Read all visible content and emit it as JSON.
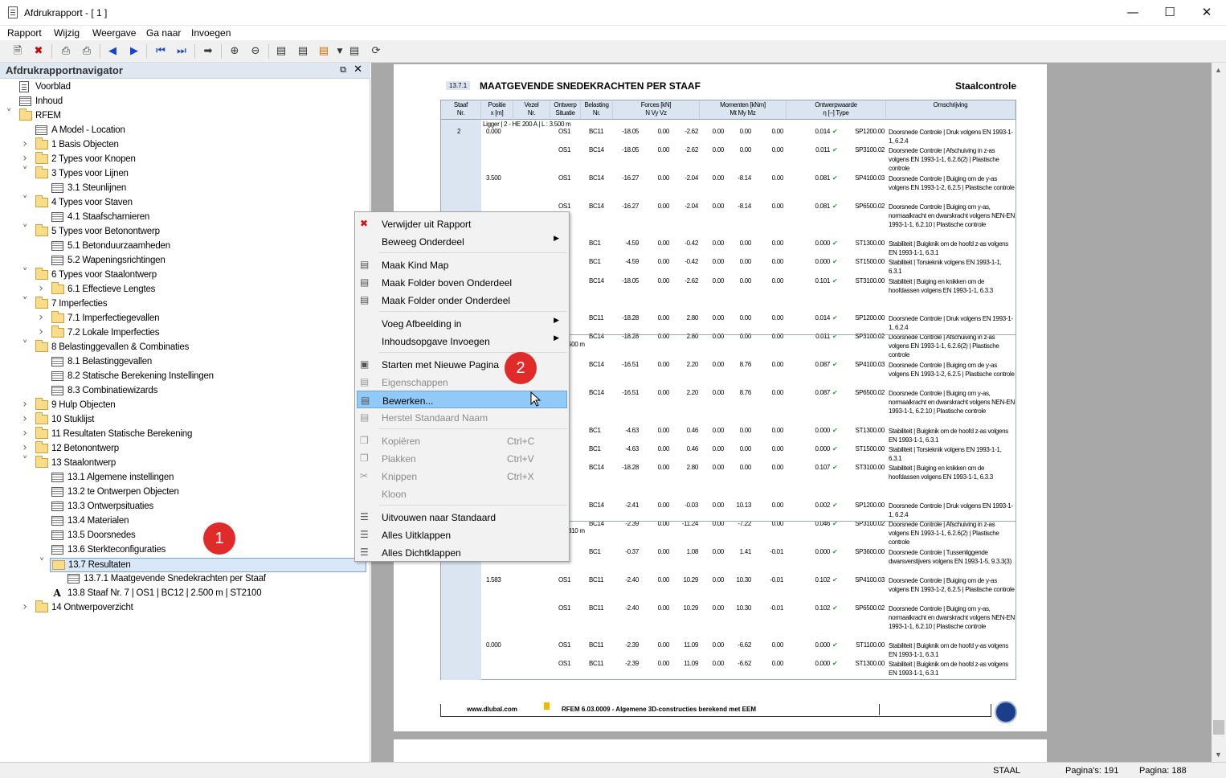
{
  "window": {
    "title": "Afdrukrapport - [ 1 ]"
  },
  "menu": [
    "Rapport",
    "Wijzig",
    "Weergave",
    "Ga naar",
    "Invoegen"
  ],
  "navigator": {
    "title": "Afdrukrapportnavigator",
    "items": [
      {
        "label": "Voorblad",
        "level": 1,
        "icon": "doc"
      },
      {
        "label": "Inhoud",
        "level": 1,
        "icon": "table"
      },
      {
        "label": "RFEM",
        "level": 0,
        "icon": "folder",
        "arrow": "down"
      },
      {
        "label": "A Model - Location",
        "level": 2,
        "icon": "table"
      },
      {
        "label": "1 Basis Objecten",
        "level": 2,
        "icon": "folder",
        "arrow": "right"
      },
      {
        "label": "2 Types voor Knopen",
        "level": 2,
        "icon": "folder",
        "arrow": "right"
      },
      {
        "label": "3 Types voor Lijnen",
        "level": 2,
        "icon": "folder",
        "arrow": "down"
      },
      {
        "label": "3.1 Steunlijnen",
        "level": 3,
        "icon": "table"
      },
      {
        "label": "4 Types voor Staven",
        "level": 2,
        "icon": "folder",
        "arrow": "down"
      },
      {
        "label": "4.1 Staafscharnieren",
        "level": 3,
        "icon": "table"
      },
      {
        "label": "5 Types voor Betonontwerp",
        "level": 2,
        "icon": "folder",
        "arrow": "down"
      },
      {
        "label": "5.1 Betonduurzaamheden",
        "level": 3,
        "icon": "table"
      },
      {
        "label": "5.2 Wapeningsrichtingen",
        "level": 3,
        "icon": "table"
      },
      {
        "label": "6 Types voor Staalontwerp",
        "level": 2,
        "icon": "folder",
        "arrow": "down"
      },
      {
        "label": "6.1 Effectieve Lengtes",
        "level": 3,
        "icon": "folder",
        "arrow": "right"
      },
      {
        "label": "7 Imperfecties",
        "level": 2,
        "icon": "folder",
        "arrow": "down"
      },
      {
        "label": "7.1 Imperfectiegevallen",
        "level": 3,
        "icon": "folder",
        "arrow": "right"
      },
      {
        "label": "7.2 Lokale Imperfecties",
        "level": 3,
        "icon": "folder",
        "arrow": "right"
      },
      {
        "label": "8 Belastinggevallen & Combinaties",
        "level": 2,
        "icon": "folder",
        "arrow": "down"
      },
      {
        "label": "8.1 Belastinggevallen",
        "level": 3,
        "icon": "table"
      },
      {
        "label": "8.2 Statische Berekening Instellingen",
        "level": 3,
        "icon": "table"
      },
      {
        "label": "8.3 Combinatiewizards",
        "level": 3,
        "icon": "table"
      },
      {
        "label": "9 Hulp Objecten",
        "level": 2,
        "icon": "folder",
        "arrow": "right"
      },
      {
        "label": "10 Stuklijst",
        "level": 2,
        "icon": "folder",
        "arrow": "right"
      },
      {
        "label": "11 Resultaten Statische Berekening",
        "level": 2,
        "icon": "folder",
        "arrow": "right"
      },
      {
        "label": "12 Betonontwerp",
        "level": 2,
        "icon": "folder",
        "arrow": "right"
      },
      {
        "label": "13 Staalontwerp",
        "level": 2,
        "icon": "folder",
        "arrow": "down"
      },
      {
        "label": "13.1 Algemene instellingen",
        "level": 3,
        "icon": "table"
      },
      {
        "label": "13.2 te Ontwerpen Objecten",
        "level": 3,
        "icon": "table"
      },
      {
        "label": "13.3 Ontwerpsituaties",
        "level": 3,
        "icon": "table"
      },
      {
        "label": "13.4 Materialen",
        "level": 3,
        "icon": "table"
      },
      {
        "label": "13.5 Doorsnedes",
        "level": 3,
        "icon": "table"
      },
      {
        "label": "13.6 Sterkteconfiguraties",
        "level": 3,
        "icon": "table"
      },
      {
        "label": "13.7 Resultaten",
        "level": 3,
        "icon": "folderopen",
        "arrow": "down",
        "selected": true
      },
      {
        "label": "13.7.1 Maatgevende Snedekrachten per Staaf",
        "level": 4,
        "icon": "table"
      },
      {
        "label": "13.8 Staaf Nr. 7 | OS1 | BC12 | 2.500 m | ST2100",
        "level": 3,
        "icon": "txt"
      },
      {
        "label": "14 Ontwerpoverzicht",
        "level": 2,
        "icon": "folder",
        "arrow": "right"
      }
    ]
  },
  "badges": [
    "1",
    "2"
  ],
  "context_menu": [
    {
      "label": "Verwijder uit Rapport",
      "icon": "delete-icon"
    },
    {
      "label": "Beweeg Onderdeel",
      "submenu": true
    },
    {
      "sep": true
    },
    {
      "label": "Maak Kind Map",
      "icon": "new-child-folder-icon"
    },
    {
      "label": "Maak Folder boven Onderdeel",
      "icon": "folder-above-icon"
    },
    {
      "label": "Maak Folder onder Onderdeel",
      "icon": "folder-below-icon"
    },
    {
      "sep": true
    },
    {
      "label": "Voeg Afbeelding in",
      "submenu": true
    },
    {
      "label": "Inhoudsopgave Invoegen",
      "submenu": true
    },
    {
      "sep": true
    },
    {
      "label": "Starten met Nieuwe Pagina",
      "icon": "new-page-icon"
    },
    {
      "label": "Eigenschappen",
      "disabled": true,
      "icon": "properties-icon"
    },
    {
      "label": "Bewerken...",
      "highlighted": true,
      "icon": "edit-icon"
    },
    {
      "label": "Herstel Standaard Naam",
      "disabled": true,
      "icon": "reset-name-icon"
    },
    {
      "sep": true
    },
    {
      "label": "Kopiëren",
      "shortcut": "Ctrl+C",
      "disabled": true,
      "icon": "copy-icon"
    },
    {
      "label": "Plakken",
      "shortcut": "Ctrl+V",
      "disabled": true,
      "icon": "paste-icon"
    },
    {
      "label": "Knippen",
      "shortcut": "Ctrl+X",
      "disabled": true,
      "icon": "cut-icon"
    },
    {
      "label": "Kloon",
      "disabled": true
    },
    {
      "sep": true
    },
    {
      "label": "Uitvouwen naar Standaard",
      "icon": "expand-default-icon"
    },
    {
      "label": "Alles Uitklappen",
      "icon": "expand-all-icon"
    },
    {
      "label": "Alles Dichtklappen",
      "icon": "collapse-all-icon"
    }
  ],
  "report": {
    "section_number": "13.7.1",
    "section_title": "MAATGEVENDE SNEDEKRACHTEN PER STAAF",
    "section_right": "Staalcontrole",
    "headers": [
      {
        "l1": "Staaf",
        "l2": "Nr."
      },
      {
        "l1": "Positie",
        "l2": "x [m]"
      },
      {
        "l1": "Vezel",
        "l2": "Nr."
      },
      {
        "l1": "Ontwerp",
        "l2": "Situatie"
      },
      {
        "l1": "Belasting",
        "l2": "Nr."
      },
      {
        "l1": "Forces [kN]",
        "l2": "N      Vy      Vz"
      },
      {
        "l1": "Momenten [kNm]",
        "l2": "Mt     My     Mz"
      },
      {
        "l1": "Ontwerpwaarde",
        "l2": "η [–]          Type"
      },
      {
        "l1": "",
        "l2": "Omschrijving"
      }
    ],
    "member_info": "Ligger | 2 - HE 200 A | L : 3.500 m",
    "member_info_partial_2": "500 m",
    "member_info_partial_3": "310 m",
    "rows": [
      {
        "staaf": "2",
        "pos": "0.000",
        "ds": "OS1",
        "bc": "BC11",
        "N": "-18.05",
        "Vy": "0.00",
        "Vz": "-2.62",
        "Mt": "0.00",
        "My": "0.00",
        "Mz": "0.00",
        "eta": "0.014",
        "type": "SP1200.00",
        "desc": "Doorsnede Controle | Druk volgens EN 1993-1-1, 6.2.4"
      },
      {
        "ds": "OS1",
        "bc": "BC14",
        "N": "-18.05",
        "Vy": "0.00",
        "Vz": "-2.62",
        "Mt": "0.00",
        "My": "0.00",
        "Mz": "0.00",
        "eta": "0.011",
        "type": "SP3100.02",
        "desc": "Doorsnede Controle | Afschuiving in z-as volgens EN 1993-1-1, 6.2.6(2) | Plastische controle"
      },
      {
        "pos": "3.500",
        "ds": "OS1",
        "bc": "BC14",
        "N": "-16.27",
        "Vy": "0.00",
        "Vz": "-2.04",
        "Mt": "0.00",
        "My": "-8.14",
        "Mz": "0.00",
        "eta": "0.081",
        "type": "SP4100.03",
        "desc": "Doorsnede Controle | Buiging om de y-as volgens EN 1993-1-2, 6.2.5 | Plastische controle"
      },
      {
        "ds": "OS1",
        "bc": "BC14",
        "N": "-16.27",
        "Vy": "0.00",
        "Vz": "-2.04",
        "Mt": "0.00",
        "My": "-8.14",
        "Mz": "0.00",
        "eta": "0.081",
        "type": "SP6500.02",
        "desc": "Doorsnede Controle | Buiging om y-as, normaalkracht en dwarskracht volgens NEN-EN 1993-1-1, 6.2.10 | Plastische controle"
      },
      {
        "ds": "1",
        "bc": "BC1",
        "N": "-4.59",
        "Vy": "0.00",
        "Vz": "-0.42",
        "Mt": "0.00",
        "My": "0.00",
        "Mz": "0.00",
        "eta": "0.000",
        "type": "ST1300.00",
        "desc": "Stabiliteit | Buigknik om de hoofd z-as volgens EN 1993-1-1, 6.3.1"
      },
      {
        "ds": "1",
        "bc": "BC1",
        "N": "-4.59",
        "Vy": "0.00",
        "Vz": "-0.42",
        "Mt": "0.00",
        "My": "0.00",
        "Mz": "0.00",
        "eta": "0.000",
        "type": "ST1500.00",
        "desc": "Stabiliteit | Torsieknik volgens EN 1993-1-1, 6.3.1"
      },
      {
        "ds": "1",
        "bc": "BC14",
        "N": "-18.05",
        "Vy": "0.00",
        "Vz": "-2.62",
        "Mt": "0.00",
        "My": "0.00",
        "Mz": "0.00",
        "eta": "0.101",
        "type": "ST3100.00",
        "desc": "Stabiliteit | Buiging en knikken om de hoofdassen volgens EN 1993-1-1, 6.3.3"
      },
      {
        "ds": "1",
        "bc": "BC11",
        "N": "-18.28",
        "Vy": "0.00",
        "Vz": "2.80",
        "Mt": "0.00",
        "My": "0.00",
        "Mz": "0.00",
        "eta": "0.014",
        "type": "SP1200.00",
        "desc": "Doorsnede Controle | Druk volgens EN 1993-1-1, 6.2.4"
      },
      {
        "ds": "1",
        "bc": "BC14",
        "N": "-18.28",
        "Vy": "0.00",
        "Vz": "2.80",
        "Mt": "0.00",
        "My": "0.00",
        "Mz": "0.00",
        "eta": "0.011",
        "type": "SP3100.02",
        "desc": "Doorsnede Controle | Afschuiving in z-as volgens EN 1993-1-1, 6.2.6(2) | Plastische controle"
      },
      {
        "ds": "",
        "bc": "BC14",
        "N": "-16.51",
        "Vy": "0.00",
        "Vz": "2.20",
        "Mt": "0.00",
        "My": "8.76",
        "Mz": "0.00",
        "eta": "0.087",
        "type": "SP4100.03",
        "desc": "Doorsnede Controle | Buiging om de y-as volgens EN 1993-1-2, 6.2.5 | Plastische controle"
      },
      {
        "ds": "",
        "bc": "BC14",
        "N": "-16.51",
        "Vy": "0.00",
        "Vz": "2.20",
        "Mt": "0.00",
        "My": "8.76",
        "Mz": "0.00",
        "eta": "0.087",
        "type": "SP6500.02",
        "desc": "Doorsnede Controle | Buiging om y-as, normaalkracht en dwarskracht volgens NEN-EN 1993-1-1, 6.2.10 | Plastische controle"
      },
      {
        "ds": "1",
        "bc": "BC1",
        "N": "-4.63",
        "Vy": "0.00",
        "Vz": "0.46",
        "Mt": "0.00",
        "My": "0.00",
        "Mz": "0.00",
        "eta": "0.000",
        "type": "ST1300.00",
        "desc": "Stabiliteit | Buigknik om de hoofd z-as volgens EN 1993-1-1, 6.3.1"
      },
      {
        "ds": "1",
        "bc": "BC1",
        "N": "-4.63",
        "Vy": "0.00",
        "Vz": "0.46",
        "Mt": "0.00",
        "My": "0.00",
        "Mz": "0.00",
        "eta": "0.000",
        "type": "ST1500.00",
        "desc": "Stabiliteit | Torsieknik volgens EN 1993-1-1, 6.3.1"
      },
      {
        "ds": "1",
        "bc": "BC14",
        "N": "-18.28",
        "Vy": "0.00",
        "Vz": "2.80",
        "Mt": "0.00",
        "My": "0.00",
        "Mz": "0.00",
        "eta": "0.107",
        "type": "ST3100.00",
        "desc": "Stabiliteit | Buiging en knikken om de hoofdassen volgens EN 1993-1-1, 6.3.3"
      },
      {
        "ds": "1",
        "bc": "BC14",
        "N": "-2.41",
        "Vy": "0.00",
        "Vz": "-0.03",
        "Mt": "0.00",
        "My": "10.13",
        "Mz": "0.00",
        "eta": "0.002",
        "type": "SP1200.00",
        "desc": "Doorsnede Controle | Druk volgens EN 1993-1-1, 6.2.4"
      },
      {
        "ds": "1",
        "bc": "BC14",
        "N": "-2.39",
        "Vy": "0.00",
        "Vz": "-11.24",
        "Mt": "0.00",
        "My": "-7.22",
        "Mz": "0.00",
        "eta": "0.046",
        "type": "SP3100.02",
        "desc": "Doorsnede Controle | Afschuiving in z-as volgens EN 1993-1-1, 6.2.6(2) | Plastische controle"
      },
      {
        "ds": "1",
        "bc": "BC1",
        "N": "-0.37",
        "Vy": "0.00",
        "Vz": "1.08",
        "Mt": "0.00",
        "My": "1.41",
        "Mz": "-0.01",
        "eta": "0.000",
        "type": "SP3600.00",
        "desc": "Doorsnede Controle | Tussenliggende dwarsverstijvers volgens EN 1993-1-5, 9.3.3(3)"
      },
      {
        "pos": "1.583",
        "ds": "OS1",
        "bc": "BC11",
        "N": "-2.40",
        "Vy": "0.00",
        "Vz": "10.29",
        "Mt": "0.00",
        "My": "10.30",
        "Mz": "-0.01",
        "eta": "0.102",
        "type": "SP4100.03",
        "desc": "Doorsnede Controle | Buiging om de y-as volgens EN 1993-1-2, 6.2.5 | Plastische controle"
      },
      {
        "ds": "OS1",
        "bc": "BC11",
        "N": "-2.40",
        "Vy": "0.00",
        "Vz": "10.29",
        "Mt": "0.00",
        "My": "10.30",
        "Mz": "-0.01",
        "eta": "0.102",
        "type": "SP6500.02",
        "desc": "Doorsnede Controle | Buiging om y-as, normaalkracht en dwarskracht volgens NEN-EN 1993-1-1, 6.2.10 | Plastische controle"
      },
      {
        "pos": "0.000",
        "ds": "OS1",
        "bc": "BC11",
        "N": "-2.39",
        "Vy": "0.00",
        "Vz": "11.09",
        "Mt": "0.00",
        "My": "-6.62",
        "Mz": "0.00",
        "eta": "0.000",
        "type": "ST1100.00",
        "desc": "Stabiliteit | Buigknik om de hoofd y-as volgens EN 1993-1-1, 6.3.1"
      },
      {
        "ds": "OS1",
        "bc": "BC11",
        "N": "-2.39",
        "Vy": "0.00",
        "Vz": "11.09",
        "Mt": "0.00",
        "My": "-6.62",
        "Mz": "0.00",
        "eta": "0.000",
        "type": "ST1300.00",
        "desc": "Stabiliteit | Buigknik om de hoofd z-as volgens EN 1993-1-1, 6.3.1"
      }
    ],
    "footer_url": "www.dlubal.com",
    "footer_text": "RFEM 6.03.0009 - Algemene 3D-constructies berekend met EEM"
  },
  "status": {
    "module": "STAAL",
    "pages_label": "Pagina's: 191",
    "page_label": "Pagina: 188"
  },
  "colors": {
    "accent": "#91c9f7",
    "header_bg": "#dbe5f1",
    "badge": "#e02b2b"
  }
}
